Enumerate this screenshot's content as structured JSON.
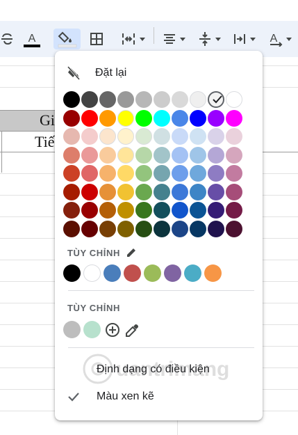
{
  "colors": {
    "toolbar_bg": "#edf2fa",
    "active_button_bg": "#d3e3fd",
    "menu_bg": "#ffffff",
    "icon": "#444746"
  },
  "toolbar": {
    "icons": [
      "strikethrough-icon",
      "text-color-icon",
      "fill-color-icon",
      "borders-icon",
      "merge-cells-icon",
      "horizontal-align-icon",
      "vertical-align-icon",
      "text-wrapping-icon",
      "text-rotation-icon"
    ],
    "active": "fill-color-icon"
  },
  "sheet": {
    "cells": {
      "header_partial": "Gi",
      "body_partial": "Tiế"
    }
  },
  "fill_menu": {
    "reset_label": "Đặt lại",
    "reset_icon": "reset-fill-icon",
    "palette": [
      [
        "#000000",
        "#434343",
        "#666666",
        "#999999",
        "#b7b7b7",
        "#cccccc",
        "#d9d9d9",
        "#efefef",
        "#f3f3f3",
        "#ffffff"
      ],
      [
        "#980000",
        "#ff0000",
        "#ff9900",
        "#ffff00",
        "#00ff00",
        "#00ffff",
        "#4a86e8",
        "#0000ff",
        "#9900ff",
        "#ff00ff"
      ],
      [
        "#e6b8af",
        "#f4cccc",
        "#fce5cd",
        "#fff2cc",
        "#d9ead3",
        "#d0e0e3",
        "#c9daf8",
        "#cfe2f3",
        "#d9d2e9",
        "#ead1dc"
      ],
      [
        "#dd7e6b",
        "#ea9999",
        "#f9cb9c",
        "#ffe599",
        "#b6d7a8",
        "#a2c4c9",
        "#a4c2f4",
        "#9fc5e8",
        "#b4a7d6",
        "#d5a6bd"
      ],
      [
        "#cc4125",
        "#e06666",
        "#f6b26b",
        "#ffd966",
        "#93c47d",
        "#76a5af",
        "#6d9eeb",
        "#6fa8dc",
        "#8e7cc3",
        "#c27ba0"
      ],
      [
        "#a61c00",
        "#cc0000",
        "#e69138",
        "#f1c232",
        "#6aa84f",
        "#45818e",
        "#3c78d8",
        "#3d85c6",
        "#674ea7",
        "#a64d79"
      ],
      [
        "#85200c",
        "#990000",
        "#b45f06",
        "#bf9000",
        "#38761d",
        "#134f5c",
        "#1155cc",
        "#0b5394",
        "#351c75",
        "#741b47"
      ],
      [
        "#5b0f00",
        "#660000",
        "#783f04",
        "#7f6000",
        "#274e13",
        "#0c343d",
        "#1c4587",
        "#073763",
        "#20124d",
        "#4c1130"
      ]
    ],
    "selected_color": "#f3f3f3",
    "theme_section": {
      "label": "TÙY CHỈNH",
      "edit_icon": "pencil-icon",
      "colors": [
        "#000000",
        "#ffffff",
        "#4a7ebb",
        "#c0504d",
        "#9bbb59",
        "#8064a2",
        "#4bacc6",
        "#f79646"
      ]
    },
    "custom_section": {
      "label": "TÙY CHỈNH",
      "colors": [
        "#bdbdbd",
        "#b7e1cd"
      ],
      "add_icon": "add-circle-icon",
      "eyedropper_icon": "eyedropper-icon"
    },
    "conditional_label": "Định dạng có điều kiện",
    "alternating_label": "Màu xen kẽ",
    "alternating_icon": "check-icon"
  }
}
